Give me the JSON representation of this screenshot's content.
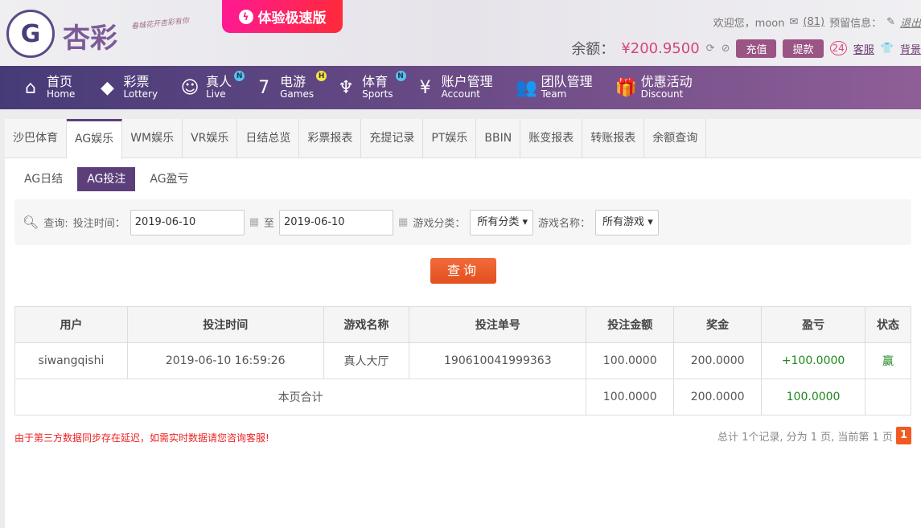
{
  "header": {
    "logo_glyph": "G",
    "brand": "杏彩",
    "slogan": "春城花开杏彩有你",
    "fast_version": "体验极速版",
    "welcome": "欢迎您，moon",
    "messages": "(81)",
    "reserved": "预留信息：",
    "logout": "退出",
    "balance_label": "余额：",
    "balance": "¥200.9500",
    "deposit": "充值",
    "withdraw": "提款",
    "service": "客服",
    "background": "背景"
  },
  "nav": [
    {
      "zh": "首页",
      "en": "Home",
      "icon": "home-icon",
      "glyph": "⌂"
    },
    {
      "zh": "彩票",
      "en": "Lottery",
      "icon": "ticket-icon",
      "glyph": "◆"
    },
    {
      "zh": "真人",
      "en": "Live",
      "icon": "dealer-icon",
      "glyph": "☺",
      "badge": "N",
      "badge_color": "#4fc3f7"
    },
    {
      "zh": "电游",
      "en": "Games",
      "icon": "seven-icon",
      "glyph": "7",
      "badge": "H",
      "badge_color": "#f5e642"
    },
    {
      "zh": "体育",
      "en": "Sports",
      "icon": "trophy-icon",
      "glyph": "♆",
      "badge": "N",
      "badge_color": "#4fc3f7"
    },
    {
      "zh": "账户管理",
      "en": "Account",
      "icon": "yen-coin-icon",
      "glyph": "¥"
    },
    {
      "zh": "团队管理",
      "en": "Team",
      "icon": "team-icon",
      "glyph": "👥"
    },
    {
      "zh": "优惠活动",
      "en": "Discount",
      "icon": "gift-icon",
      "glyph": "🎁"
    }
  ],
  "tabs": [
    "沙巴体育",
    "AG娱乐",
    "WM娱乐",
    "VR娱乐",
    "日结总览",
    "彩票报表",
    "充提记录",
    "PT娱乐",
    "BBIN",
    "账变报表",
    "转账报表",
    "余额查询"
  ],
  "active_tab": "AG娱乐",
  "subtabs": [
    "AG日结",
    "AG投注",
    "AG盈亏"
  ],
  "active_subtab": "AG投注",
  "filter": {
    "query_label": "查询:",
    "time_label": "投注时间：",
    "start": "2019-06-10",
    "to": "至",
    "end": "2019-06-10",
    "category_label": "游戏分类：",
    "category": "所有分类",
    "name_label": "游戏名称：",
    "name": "所有游戏",
    "search": "查询"
  },
  "table": {
    "headers": [
      "用户",
      "投注时间",
      "游戏名称",
      "投注单号",
      "投注金额",
      "奖金",
      "盈亏",
      "状态"
    ],
    "rows": [
      [
        "siwangqishi",
        "2019-06-10 16:59:26",
        "真人大厅",
        "190610041999363",
        "100.0000",
        "200.0000",
        "+100.0000",
        "赢"
      ]
    ],
    "total": {
      "label": "本页合计",
      "bet": "100.0000",
      "prize": "200.0000",
      "profit": "100.0000"
    }
  },
  "note": "由于第三方数据同步存在延迟，如需实时数据请您咨询客服!",
  "pagination": {
    "summary": "总计 1个记录, 分为 1 页, 当前第 1 页",
    "current": "1"
  }
}
